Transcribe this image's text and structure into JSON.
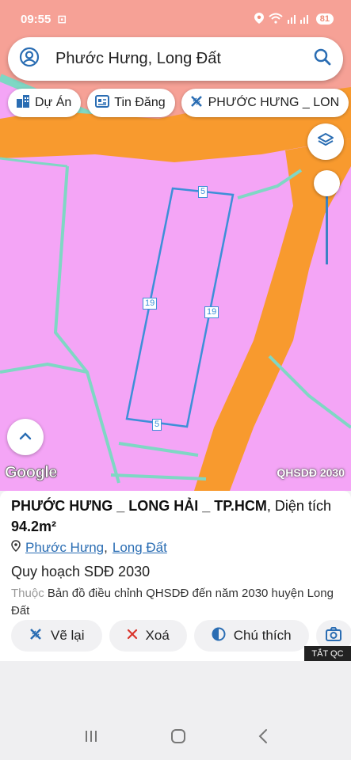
{
  "status": {
    "time": "09:55",
    "battery": "81"
  },
  "search": {
    "text": "Phước Hưng, Long Đất"
  },
  "chips": [
    {
      "label": "Dự Án",
      "icon": "building-icon"
    },
    {
      "label": "Tin Đăng",
      "icon": "listing-icon"
    },
    {
      "label": "PHƯỚC HƯNG _ LON",
      "icon": "measure-icon"
    }
  ],
  "map": {
    "parcel_edges": {
      "top": "5",
      "left": "19",
      "right": "19",
      "bottom": "5"
    },
    "attribution": "Google",
    "layer_badge": "QHSDĐ 2030",
    "colors": {
      "residential": "#f4a5f6",
      "road": "#f89a2e",
      "boundary": "#7fd7c4",
      "top_zone": "#f6a196",
      "parcel_line": "#3d8fd8"
    }
  },
  "info": {
    "title": "PHƯỚC HƯNG _ LONG HẢI _ TP.HCM",
    "area_prefix": ", Diện tích ",
    "area_value": "94.2m²",
    "location_1": "Phước Hưng",
    "location_sep": ",",
    "location_2": "Long Đất",
    "plan": "Quy hoạch SDĐ 2030",
    "belongs_label": "Thuộc",
    "belongs_text": " Bản đồ điều chỉnh QHSDĐ đến năm 2030 huyện Long Đất"
  },
  "actions": [
    {
      "label": "Vẽ lại",
      "icon": "redraw-icon"
    },
    {
      "label": "Xoá",
      "icon": "close-icon"
    },
    {
      "label": "Chú thích",
      "icon": "legend-icon"
    }
  ],
  "ad_toggle": "TẮT QC"
}
